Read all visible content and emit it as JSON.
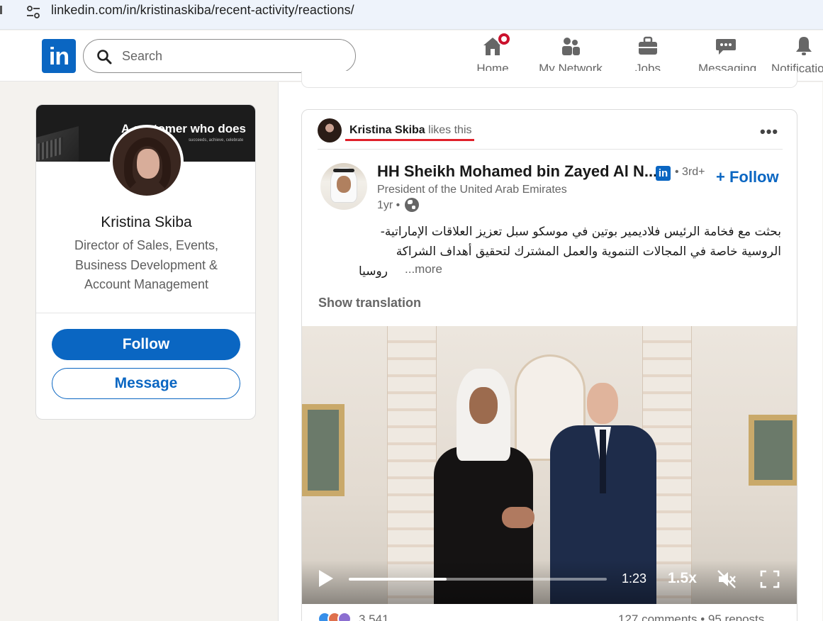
{
  "browser": {
    "url": "linkedin.com/in/kristinaskiba/recent-activity/reactions/"
  },
  "nav": {
    "logo": "in",
    "search_placeholder": "Search",
    "items": [
      {
        "label": "Home",
        "icon": "home-icon",
        "badge": true
      },
      {
        "label": "My Network",
        "icon": "network-icon"
      },
      {
        "label": "Jobs",
        "icon": "briefcase-icon"
      },
      {
        "label": "Messaging",
        "icon": "messaging-icon"
      },
      {
        "label": "Notifications",
        "icon": "bell-icon"
      }
    ]
  },
  "profile": {
    "banner_text": "A customer who does",
    "banner_subtext": "succeeds, achieve, celebrate",
    "name": "Kristina Skiba",
    "title": "Director of Sales, Events, Business Development & Account Management",
    "follow_label": "Follow",
    "message_label": "Message"
  },
  "post": {
    "liker_name": "Kristina Skiba",
    "liker_action": " likes this",
    "author_name": "HH Sheikh Mohamed bin Zayed Al N...",
    "degree": "• 3rd+",
    "follow_label": "+ Follow",
    "author_headline": "President of the United Arab Emirates",
    "time": "1yr •",
    "text_line1": "بحثت مع فخامة الرئيس فلاديمير بوتين في موسكو سبل تعزيز العلاقات الإماراتية-",
    "text_line2": "الروسية خاصة في المجالات التنموية والعمل المشترك لتحقيق أهداف الشراكة",
    "text_line3": "روسيا",
    "see_more": "...more",
    "show_translation": "Show translation",
    "video": {
      "time": "1:23",
      "speed": "1.5x",
      "progress": 0.38
    },
    "reactions_count": "3,541",
    "comments_reposts": "127 comments • 95 reposts"
  },
  "colors": {
    "brand": "#0a66c2",
    "notification": "#cb112d",
    "highlight_underline": "#e0202a"
  }
}
